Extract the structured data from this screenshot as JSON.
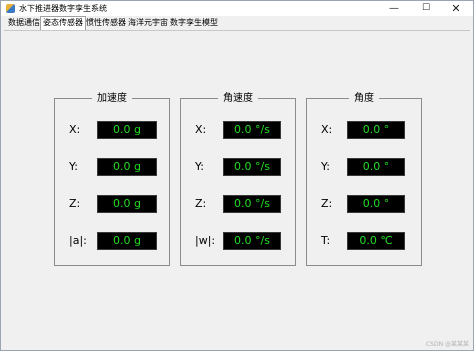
{
  "window": {
    "title": "水下推进器数字孪生系统",
    "minimize": "—",
    "maximize": "☐",
    "close": "✕"
  },
  "tabs": [
    {
      "label": "数据通信",
      "active": false
    },
    {
      "label": "姿态传感器",
      "active": true
    },
    {
      "label": "惯性传感器",
      "active": false
    },
    {
      "label": "海洋元宇宙",
      "active": false
    },
    {
      "label": "数字孪生模型",
      "active": false
    }
  ],
  "groups": {
    "acceleration": {
      "title": "加速度",
      "rows": [
        {
          "label": "X:",
          "value": "0.0 g"
        },
        {
          "label": "Y:",
          "value": "0.0 g"
        },
        {
          "label": "Z:",
          "value": "0.0 g"
        },
        {
          "label": "|a|:",
          "value": "0.0 g"
        }
      ]
    },
    "angular_velocity": {
      "title": "角速度",
      "rows": [
        {
          "label": "X:",
          "value": "0.0 °/s"
        },
        {
          "label": "Y:",
          "value": "0.0 °/s"
        },
        {
          "label": "Z:",
          "value": "0.0 °/s"
        },
        {
          "label": "|w|:",
          "value": "0.0 °/s"
        }
      ]
    },
    "angle": {
      "title": "角度",
      "rows": [
        {
          "label": "X:",
          "value": "0.0 °"
        },
        {
          "label": "Y:",
          "value": "0.0 °"
        },
        {
          "label": "Z:",
          "value": "0.0 °"
        },
        {
          "label": "T:",
          "value": "0.0 ℃"
        }
      ]
    }
  },
  "watermark": "CSDN @某某某",
  "colors": {
    "lcd_background": "#000000",
    "lcd_text": "#22dd22",
    "window_background": "#f0f0f0"
  }
}
